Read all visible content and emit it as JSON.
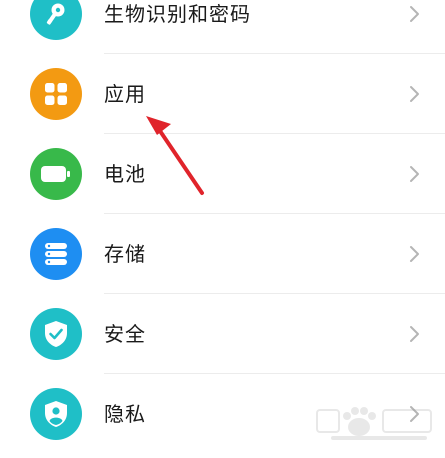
{
  "settings": {
    "items": [
      {
        "label": "生物识别和密码",
        "icon": "key-icon",
        "color": "#1fbfc7"
      },
      {
        "label": "应用",
        "icon": "apps-grid-icon",
        "color": "#f39a12"
      },
      {
        "label": "电池",
        "icon": "battery-icon",
        "color": "#38b94a"
      },
      {
        "label": "存储",
        "icon": "storage-icon",
        "color": "#1e8ef2"
      },
      {
        "label": "安全",
        "icon": "shield-check-icon",
        "color": "#1fbfc7"
      },
      {
        "label": "隐私",
        "icon": "privacy-shield-icon",
        "color": "#1fbfc7"
      }
    ]
  },
  "annotation": {
    "arrow_color": "#e0242b"
  }
}
